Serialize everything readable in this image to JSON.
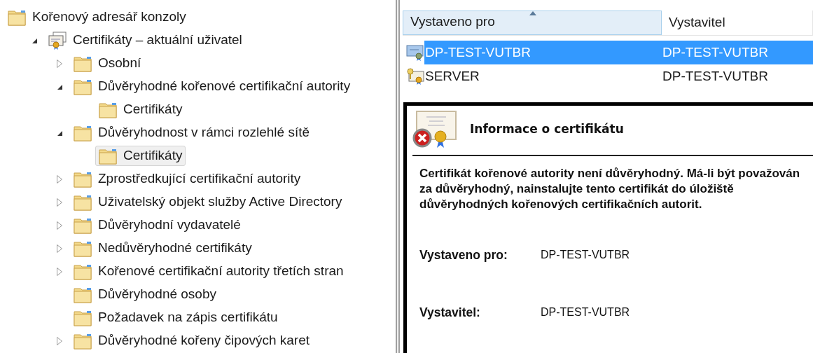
{
  "tree": [
    {
      "label": "Kořenový adresář konzoly",
      "kind": "folder",
      "selected": false,
      "children": [
        {
          "label": "Certifikáty – aktuální uživatel",
          "kind": "certificate-store",
          "expanded": true,
          "selected": false,
          "children": [
            {
              "label": "Osobní",
              "kind": "folder",
              "expanded": false,
              "selected": false
            },
            {
              "label": "Důvěryhodné kořenové certifikační autority",
              "kind": "folder",
              "expanded": true,
              "selected": false,
              "children": [
                {
                  "label": "Certifikáty",
                  "kind": "folder",
                  "selected": false
                }
              ]
            },
            {
              "label": "Důvěryhodnost v rámci rozlehlé sítě",
              "kind": "folder",
              "expanded": true,
              "selected": false,
              "children": [
                {
                  "label": "Certifikáty",
                  "kind": "folder",
                  "selected": true
                }
              ]
            },
            {
              "label": "Zprostředkující certifikační autority",
              "kind": "folder",
              "expanded": false,
              "selected": false
            },
            {
              "label": "Uživatelský objekt služby Active Directory",
              "kind": "folder",
              "expanded": false,
              "selected": false
            },
            {
              "label": "Důvěryhodní vydavatelé",
              "kind": "folder",
              "expanded": false,
              "selected": false
            },
            {
              "label": "Nedůvěryhodné certifikáty",
              "kind": "folder",
              "expanded": false,
              "selected": false
            },
            {
              "label": "Kořenové certifikační autority třetích stran",
              "kind": "folder",
              "expanded": false,
              "selected": false
            },
            {
              "label": "Důvěryhodné osoby",
              "kind": "folder",
              "selected": false
            },
            {
              "label": "Požadavek na zápis certifikátu",
              "kind": "folder",
              "selected": false
            },
            {
              "label": "Důvěryhodné kořeny čipových karet",
              "kind": "folder",
              "expanded": false,
              "selected": false
            }
          ]
        }
      ]
    }
  ],
  "list": {
    "columns": [
      {
        "label": "Vystaveno pro",
        "sorted": true
      },
      {
        "label": "Vystavitel",
        "sorted": false
      }
    ],
    "rows": [
      {
        "kind": "certificate",
        "issued_to": "DP-TEST-VUTBR",
        "issuer": "DP-TEST-VUTBR",
        "selected": true
      },
      {
        "kind": "key-certificate",
        "issued_to": "SERVER",
        "issuer": "DP-TEST-VUTBR",
        "selected": false
      }
    ]
  },
  "certificate_info": {
    "title": "Informace o certifikátu",
    "message": "Certifikát kořenové autority není důvěryhodný. Má-li být považován za důvěryhodný, nainstalujte tento certifikát do úložiště důvěryhodných kořenových certifikačních autorit.",
    "fields": [
      {
        "label": "Vystaveno pro:",
        "value": "DP-TEST-VUTBR"
      },
      {
        "label": "Vystavitel:",
        "value": "DP-TEST-VUTBR"
      }
    ]
  }
}
